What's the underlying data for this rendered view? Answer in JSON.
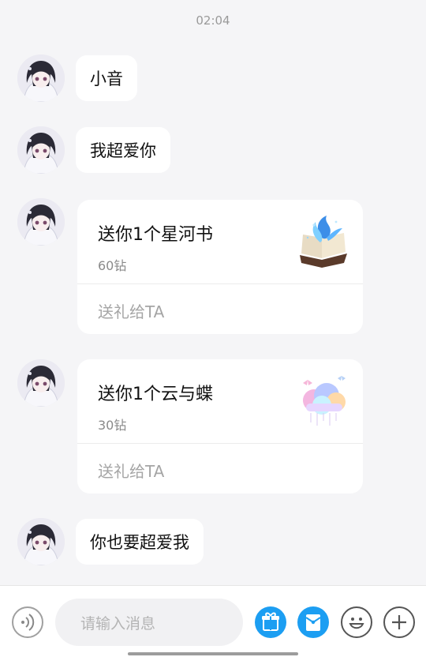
{
  "chat": {
    "time": "02:04",
    "messages": [
      {
        "text": "小音"
      },
      {
        "text": "我超爱你"
      },
      {
        "text": "你也要超爱我"
      }
    ],
    "gifts": [
      {
        "title": "送你1个星河书",
        "price": "60钻",
        "action": "送礼给TA",
        "art_icon": "star-river-book-icon"
      },
      {
        "title": "送你1个云与蝶",
        "price": "30钻",
        "action": "送礼给TA",
        "art_icon": "cloud-butterfly-icon"
      }
    ]
  },
  "composer": {
    "placeholder": "请输入消息",
    "icons": [
      "voice-icon",
      "gift-icon",
      "red-packet-icon",
      "emoji-icon",
      "plus-icon"
    ],
    "accent": "#1c9ef2"
  }
}
